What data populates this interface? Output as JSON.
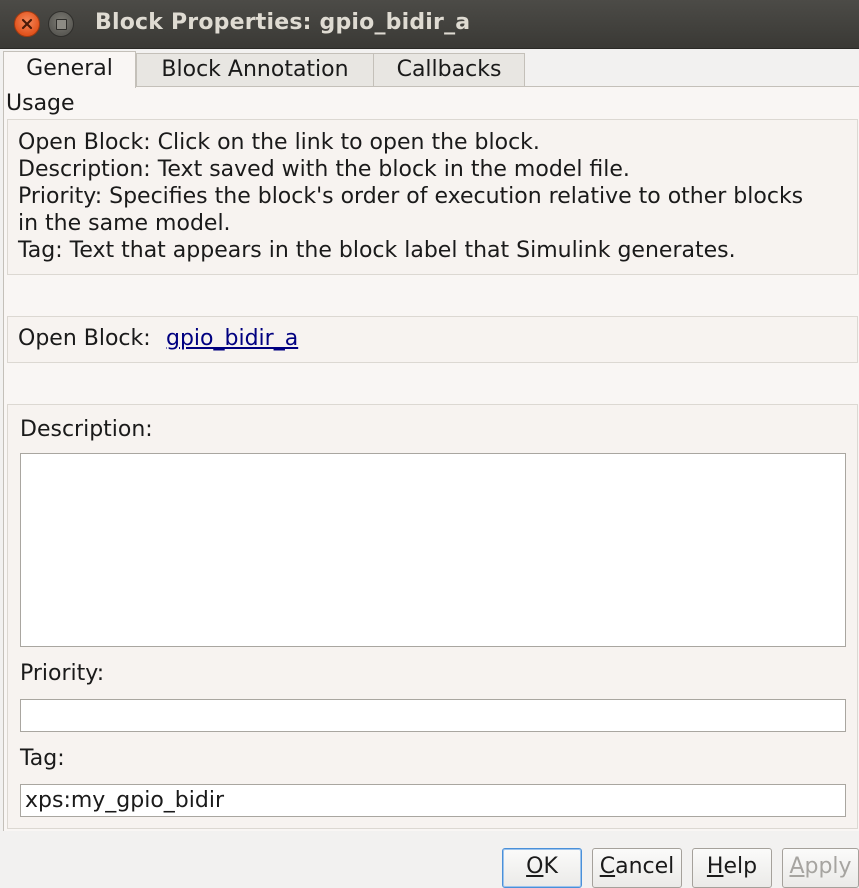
{
  "window": {
    "title": "Block Properties: gpio_bidir_a"
  },
  "tabs": [
    {
      "label": "General",
      "active": true
    },
    {
      "label": "Block Annotation",
      "active": false
    },
    {
      "label": "Callbacks",
      "active": false
    }
  ],
  "usage": {
    "label": "Usage",
    "lines": [
      "Open Block: Click on the link to open the block.",
      "Description: Text saved with the block in the model file.",
      "Priority: Specifies the block's order of execution relative to other blocks",
      "in the same model.",
      "Tag: Text that appears in the block label that Simulink generates."
    ]
  },
  "open_block": {
    "label": "Open Block:",
    "link_text": "gpio_bidir_a"
  },
  "fields": {
    "description_label": "Description:",
    "description_value": "",
    "priority_label": "Priority:",
    "priority_value": "",
    "tag_label": "Tag:",
    "tag_value": "xps:my_gpio_bidir"
  },
  "buttons": {
    "ok": {
      "mnemonic": "O",
      "rest": "K"
    },
    "cancel": {
      "mnemonic": "C",
      "rest": "ancel"
    },
    "help": {
      "mnemonic": "H",
      "rest": "elp"
    },
    "apply": {
      "mnemonic": "A",
      "rest": "pply",
      "disabled": true
    }
  },
  "colors": {
    "titlebar": "#3a3935",
    "close_button": "#e2531d",
    "link": "#000080",
    "default_button_border": "#4a90d9"
  }
}
